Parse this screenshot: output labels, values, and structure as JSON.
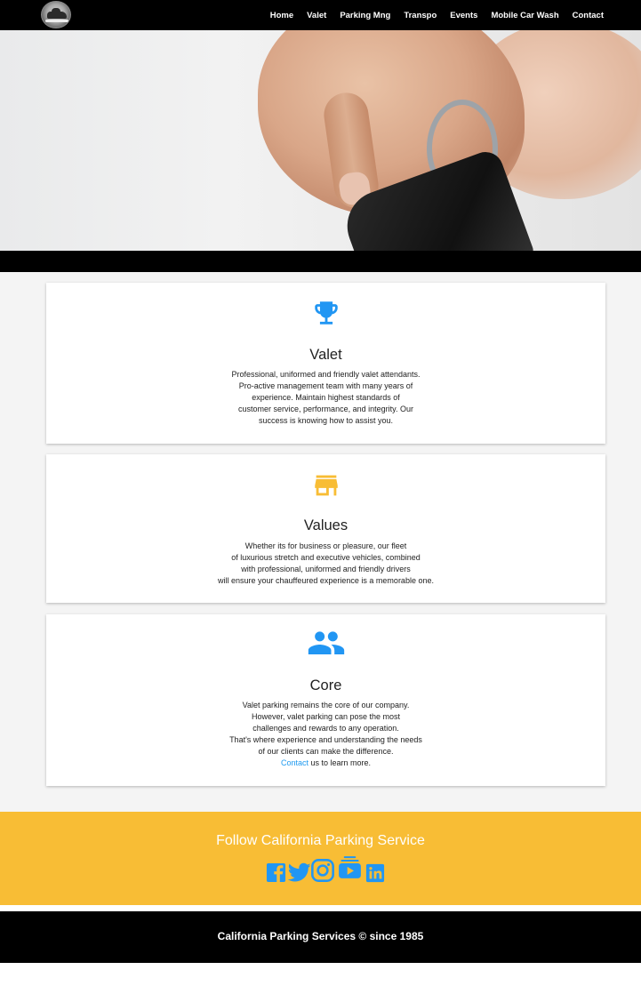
{
  "nav": {
    "items": [
      {
        "label": "Home"
      },
      {
        "label": "Valet"
      },
      {
        "label": "Parking Mng"
      },
      {
        "label": "Transpo"
      },
      {
        "label": "Events"
      },
      {
        "label": "Mobile Car Wash"
      },
      {
        "label": "Contact"
      }
    ]
  },
  "cards": [
    {
      "icon": "trophy-icon",
      "icon_color": "#2196f3",
      "title": "Valet",
      "lines": [
        "Professional, uniformed and friendly valet attendants.",
        "Pro-active management team with many years of",
        "experience. Maintain highest standards of",
        "customer service, performance, and integrity. Our",
        "success is knowing how to assist you."
      ]
    },
    {
      "icon": "store-icon",
      "icon_color": "#f8bd35",
      "title": "Values",
      "lines": [
        "Whether its for business or pleasure, our fleet",
        "of luxurious stretch and executive vehicles, combined",
        "with professional, uniformed and friendly drivers",
        "will ensure your chauffeured experience is a memorable one."
      ]
    },
    {
      "icon": "people-icon",
      "icon_color": "#2196f3",
      "title": "Core",
      "lines": [
        "Valet parking remains the core of our company.",
        "However, valet parking can pose the most",
        "challenges and rewards to any operation.",
        "That's where experience and understanding the needs",
        "of our clients can make the difference."
      ],
      "link_text": "Contact",
      "link_suffix": " us to learn more."
    }
  ],
  "social": {
    "heading": "Follow California Parking Service",
    "icons": [
      "facebook-icon",
      "twitter-icon",
      "instagram-icon",
      "youtube-icon",
      "linkedin-icon"
    ],
    "color": "#2196f3"
  },
  "footer": {
    "text": "California Parking Services © since 1985"
  },
  "colors": {
    "accent_blue": "#2196f3",
    "accent_yellow": "#f8bd35",
    "link": "#1e9af0"
  }
}
